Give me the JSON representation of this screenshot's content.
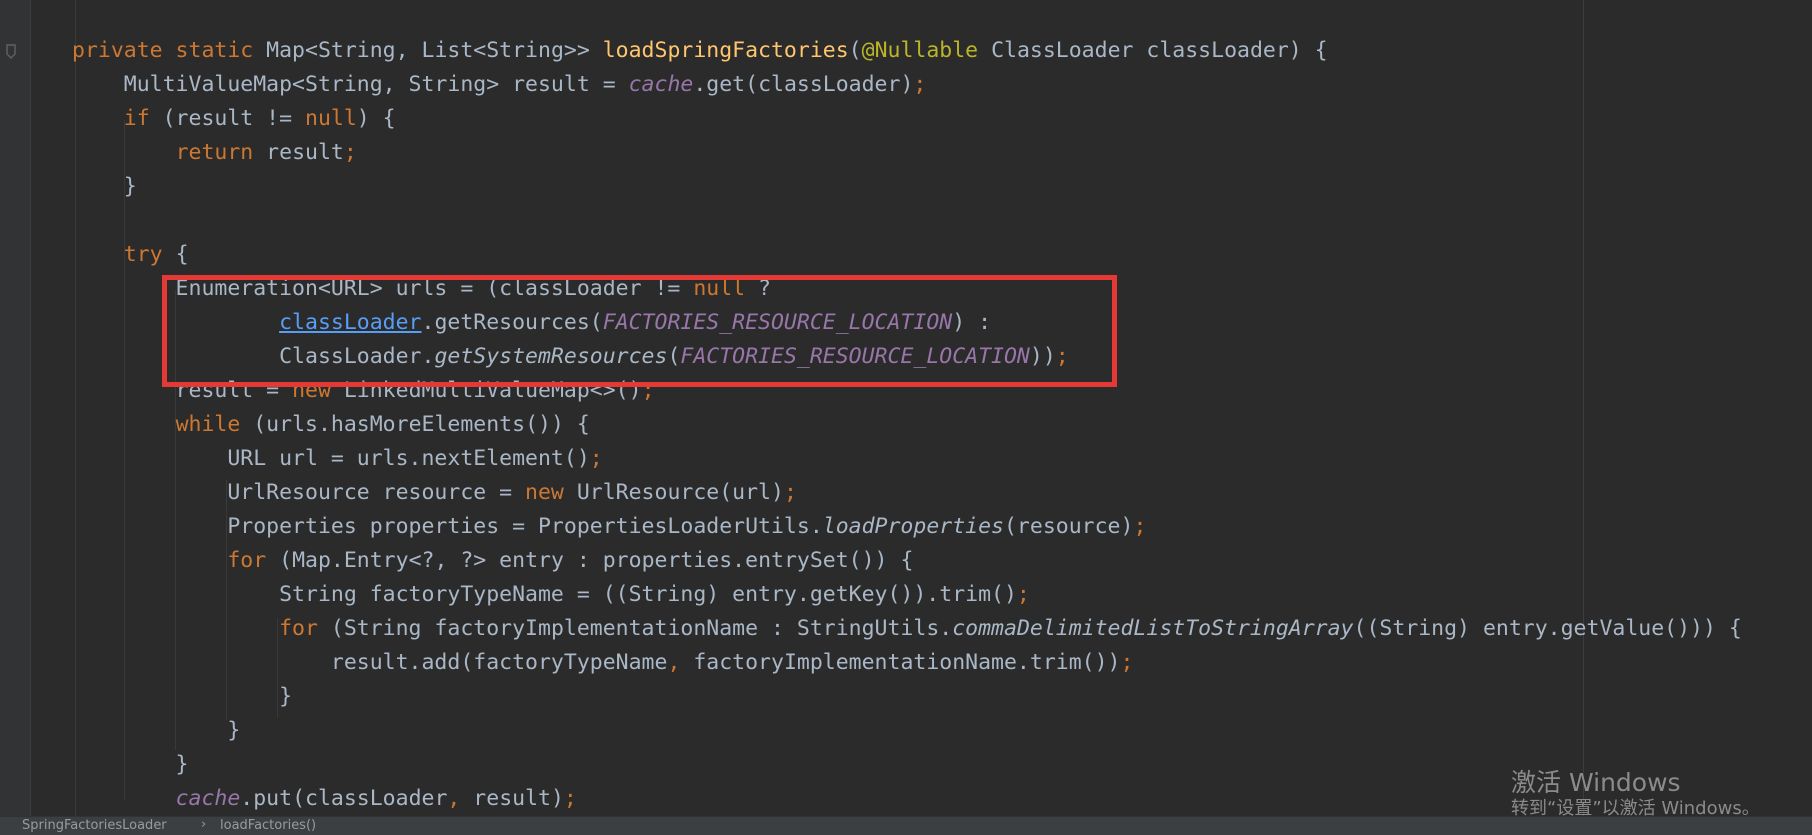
{
  "code_lines": [
    {
      "segments": [
        {
          "t": "private static ",
          "c": "kw"
        },
        {
          "t": "Map<String, List<String>> ",
          "c": ""
        },
        {
          "t": "loadSpringFactories",
          "c": "fn"
        },
        {
          "t": "(",
          "c": ""
        },
        {
          "t": "@Nullable",
          "c": "ann"
        },
        {
          "t": " ClassLoader classLoader) {",
          "c": ""
        }
      ]
    },
    {
      "segments": [
        {
          "t": "    MultiValueMap<String, String> result = ",
          "c": ""
        },
        {
          "t": "cache",
          "c": "static-field"
        },
        {
          "t": ".get(classLoader)",
          "c": ""
        },
        {
          "t": ";",
          "c": "punc"
        }
      ]
    },
    {
      "segments": [
        {
          "t": "    ",
          "c": ""
        },
        {
          "t": "if",
          "c": "kw"
        },
        {
          "t": " (result != ",
          "c": ""
        },
        {
          "t": "null",
          "c": "kw"
        },
        {
          "t": ") {",
          "c": ""
        }
      ]
    },
    {
      "segments": [
        {
          "t": "        ",
          "c": ""
        },
        {
          "t": "return",
          "c": "kw"
        },
        {
          "t": " result",
          "c": ""
        },
        {
          "t": ";",
          "c": "punc"
        }
      ]
    },
    {
      "segments": [
        {
          "t": "    }",
          "c": ""
        }
      ]
    },
    {
      "segments": [
        {
          "t": "",
          "c": ""
        }
      ]
    },
    {
      "segments": [
        {
          "t": "    ",
          "c": ""
        },
        {
          "t": "try",
          "c": "kw"
        },
        {
          "t": " {",
          "c": ""
        }
      ]
    },
    {
      "segments": [
        {
          "t": "        Enumeration<URL> urls = (classLoader != ",
          "c": ""
        },
        {
          "t": "null",
          "c": "kw"
        },
        {
          "t": " ?",
          "c": ""
        }
      ]
    },
    {
      "segments": [
        {
          "t": "                ",
          "c": ""
        },
        {
          "t": "classLoader",
          "c": "link"
        },
        {
          "t": ".getResources(",
          "c": ""
        },
        {
          "t": "FACTORIES_RESOURCE_LOCATION",
          "c": "static-field"
        },
        {
          "t": ") :",
          "c": ""
        }
      ]
    },
    {
      "segments": [
        {
          "t": "                ClassLoader.",
          "c": ""
        },
        {
          "t": "getSystemResources",
          "c": "static-call"
        },
        {
          "t": "(",
          "c": ""
        },
        {
          "t": "FACTORIES_RESOURCE_LOCATION",
          "c": "static-field"
        },
        {
          "t": "))",
          "c": ""
        },
        {
          "t": ";",
          "c": "punc"
        }
      ]
    },
    {
      "segments": [
        {
          "t": "        result = ",
          "c": ""
        },
        {
          "t": "new",
          "c": "kw"
        },
        {
          "t": " LinkedMultiValueMap<>()",
          "c": ""
        },
        {
          "t": ";",
          "c": "punc"
        }
      ]
    },
    {
      "segments": [
        {
          "t": "        ",
          "c": ""
        },
        {
          "t": "while",
          "c": "kw"
        },
        {
          "t": " (urls.hasMoreElements()) {",
          "c": ""
        }
      ]
    },
    {
      "segments": [
        {
          "t": "            URL url = urls.nextElement()",
          "c": ""
        },
        {
          "t": ";",
          "c": "punc"
        }
      ]
    },
    {
      "segments": [
        {
          "t": "            UrlResource resource = ",
          "c": ""
        },
        {
          "t": "new",
          "c": "kw"
        },
        {
          "t": " UrlResource(url)",
          "c": ""
        },
        {
          "t": ";",
          "c": "punc"
        }
      ]
    },
    {
      "segments": [
        {
          "t": "            Properties properties = PropertiesLoaderUtils.",
          "c": ""
        },
        {
          "t": "loadProperties",
          "c": "static-call"
        },
        {
          "t": "(resource)",
          "c": ""
        },
        {
          "t": ";",
          "c": "punc"
        }
      ]
    },
    {
      "segments": [
        {
          "t": "            ",
          "c": ""
        },
        {
          "t": "for",
          "c": "kw"
        },
        {
          "t": " (Map.Entry<?, ?> entry : properties.entrySet()) {",
          "c": ""
        }
      ]
    },
    {
      "segments": [
        {
          "t": "                String factoryTypeName = ((String) entry.getKey()).trim()",
          "c": ""
        },
        {
          "t": ";",
          "c": "punc"
        }
      ]
    },
    {
      "segments": [
        {
          "t": "                ",
          "c": ""
        },
        {
          "t": "for",
          "c": "kw"
        },
        {
          "t": " (String factoryImplementationName : StringUtils.",
          "c": ""
        },
        {
          "t": "commaDelimitedListToStringArray",
          "c": "static-call"
        },
        {
          "t": "((String) entry.getValue())) {",
          "c": ""
        }
      ]
    },
    {
      "segments": [
        {
          "t": "                    result.add(factoryTypeName",
          "c": ""
        },
        {
          "t": ",",
          "c": "punc"
        },
        {
          "t": " factoryImplementationName.trim())",
          "c": ""
        },
        {
          "t": ";",
          "c": "punc"
        }
      ]
    },
    {
      "segments": [
        {
          "t": "                }",
          "c": ""
        }
      ]
    },
    {
      "segments": [
        {
          "t": "            }",
          "c": ""
        }
      ]
    },
    {
      "segments": [
        {
          "t": "        }",
          "c": ""
        }
      ]
    },
    {
      "segments": [
        {
          "t": "        ",
          "c": ""
        },
        {
          "t": "cache",
          "c": "static-field"
        },
        {
          "t": ".put(classLoader",
          "c": ""
        },
        {
          "t": ",",
          "c": "punc"
        },
        {
          "t": " result)",
          "c": ""
        },
        {
          "t": ";",
          "c": "punc"
        }
      ]
    }
  ],
  "breadcrumb": {
    "class_name": "SpringFactoriesLoader",
    "separator": "›",
    "method_name": "loadFactories()"
  },
  "watermark": {
    "title": "激活 Windows",
    "subtitle": "转到“设置”以激活 Windows。"
  },
  "colors": {
    "background": "#2b2b2b",
    "keyword": "#cc7832",
    "method_decl": "#ffc66d",
    "annotation": "#bbb529",
    "static_field": "#9876aa",
    "link": "#589df6",
    "highlight_border": "#e53935"
  },
  "icons": {
    "gutter": "bookmark-gutter-icon"
  }
}
